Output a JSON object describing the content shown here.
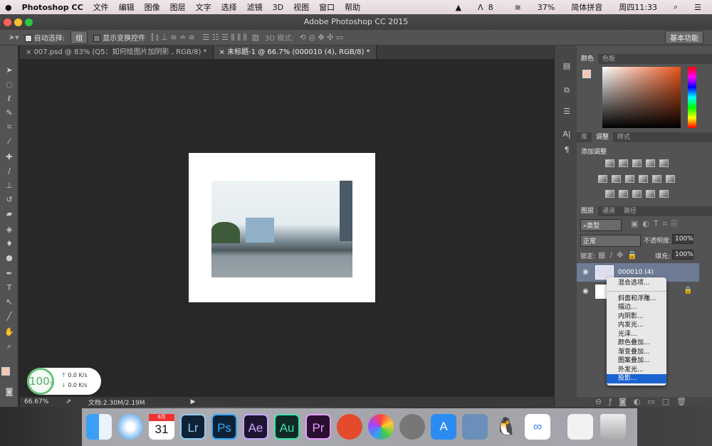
{
  "menubar": {
    "app": "Photoshop CC",
    "items": [
      "文件",
      "编辑",
      "图像",
      "图层",
      "文字",
      "选择",
      "滤镜",
      "3D",
      "视图",
      "窗口",
      "帮助"
    ],
    "status": {
      "adobe": "8",
      "battery": "37%",
      "ime": "简体拼音",
      "clock": "周四11:33"
    }
  },
  "window": {
    "title": "Adobe Photoshop CC 2015"
  },
  "options": {
    "auto_select_label": "自动选择:",
    "auto_select_value": "组",
    "show_transform": "显示变换控件",
    "mode_3d": "3D 模式:",
    "workspace": "基本功能"
  },
  "tabs": [
    {
      "label": "007.psd @ 83% (Q5：如何给图片加阴影 , RGB/8) *"
    },
    {
      "label": "未标题-1 @ 66.7% (000010 (4), RGB/8) *"
    }
  ],
  "panels": {
    "color_tabs": [
      "颜色",
      "色板"
    ],
    "adjust_tabs": [
      "库",
      "调整",
      "样式"
    ],
    "adjust_title": "添加调整",
    "layer_tabs": [
      "图层",
      "通道",
      "路径"
    ],
    "filter_kind": "类型",
    "blend_mode": "正常",
    "opacity_label": "不透明度:",
    "opacity": "100%",
    "lock_label": "锁定:",
    "fill_label": "填充:",
    "fill": "100%",
    "layers": [
      {
        "name": "000010 (4)",
        "selected": true
      },
      {
        "name": "",
        "locked": true
      }
    ]
  },
  "context_menu": {
    "items": [
      "混合选项...",
      "斜面和浮雕...",
      "描边...",
      "内阴影...",
      "内发光...",
      "光泽...",
      "颜色叠加...",
      "渐变叠加...",
      "图案叠加...",
      "外发光...",
      "投影..."
    ],
    "highlighted": "投影..."
  },
  "statusbar": {
    "zoom": "66.67%",
    "doc": "文档:2.30M/2.19M"
  },
  "network": {
    "percent": "100",
    "unit": "%",
    "up": "0.0 K/s",
    "down": "0.0 K/s"
  },
  "dock": {
    "calendar_month": "8月",
    "calendar_day": "31",
    "apps": [
      "Lr",
      "Ps",
      "Ae",
      "Au",
      "Pr"
    ]
  },
  "colors": {
    "foreground": "#f0c9b5",
    "highlight": "#1a63d0",
    "ps_blue": "#31a8ff"
  }
}
